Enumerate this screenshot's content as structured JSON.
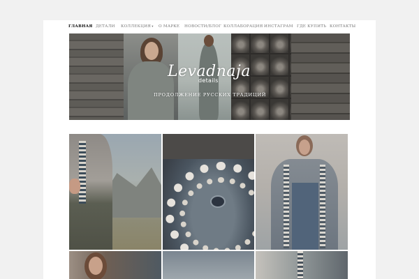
{
  "nav": {
    "items": [
      {
        "label": "ГЛАВНАЯ",
        "active": true
      },
      {
        "label": "ДЕТАЛИ"
      },
      {
        "label": "КОЛЛЕКЦИЯ",
        "has_dropdown": true
      },
      {
        "label": "О МАРКЕ"
      },
      {
        "label": "НОВОСТИ/БЛОГ"
      },
      {
        "label": "КОЛЛАБОРАЦИЯ"
      },
      {
        "label": "ИНСТАГРАМ"
      },
      {
        "label": "ГДЕ КУПИТЬ"
      },
      {
        "label": "КОНТАКТЫ"
      }
    ],
    "dropdown_caret": "▾"
  },
  "banner": {
    "logo": "Levadnaja",
    "logo_sub": "details",
    "tagline": "ПРОДОЛЖЕНИЕ РУССКИХ ТРАДИЦИЙ"
  },
  "colors": {
    "page_bg": "#f1f1f1",
    "content_bg": "#ffffff",
    "nav_active": "#111111",
    "nav_text": "#777777",
    "banner_text": "#ffffff"
  }
}
